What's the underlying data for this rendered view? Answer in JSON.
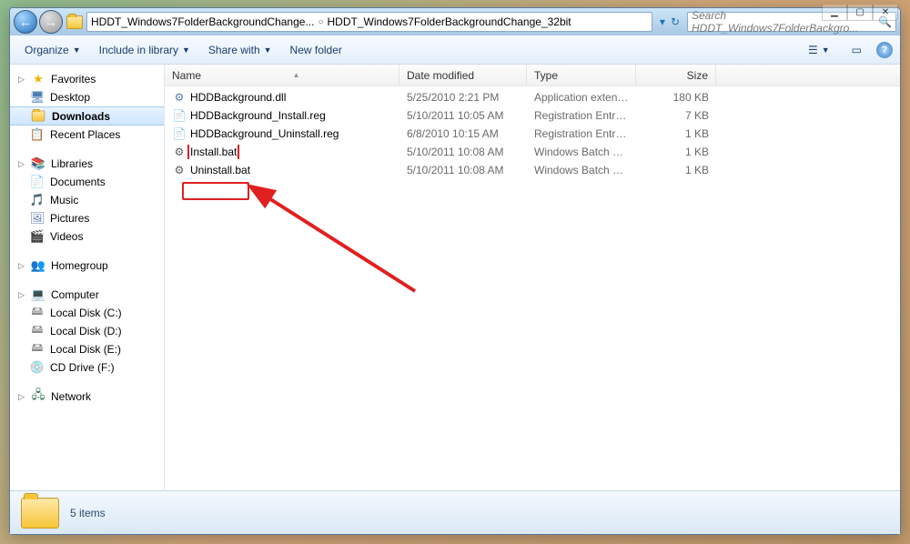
{
  "titlebar": {
    "back_glyph": "←",
    "fwd_glyph": "→",
    "breadcrumb": {
      "seg1": "HDDT_Windows7FolderBackgroundChange...",
      "seg2": "HDDT_Windows7FolderBackgroundChange_32bit"
    },
    "refresh_glyph": "↻",
    "dropdown_glyph": "▾",
    "search_placeholder": "Search HDDT_Windows7FolderBackgro...",
    "search_glyph": "🔍"
  },
  "winbtns": {
    "min": "▁",
    "max": "▢",
    "close": "✕"
  },
  "toolbar": {
    "organize": "Organize",
    "include": "Include in library",
    "share": "Share with",
    "newfolder": "New folder",
    "view_glyph": "☰",
    "preview_glyph": "▭",
    "help_glyph": "?"
  },
  "sidebar": {
    "favorites": "Favorites",
    "desktop": "Desktop",
    "downloads": "Downloads",
    "recent": "Recent Places",
    "libraries": "Libraries",
    "documents": "Documents",
    "music": "Music",
    "pictures": "Pictures",
    "videos": "Videos",
    "homegroup": "Homegroup",
    "computer": "Computer",
    "localC": "Local Disk (C:)",
    "localD": "Local Disk (D:)",
    "localE": "Local Disk (E:)",
    "cdF": "CD Drive (F:)",
    "network": "Network"
  },
  "columns": {
    "name": "Name",
    "date": "Date modified",
    "type": "Type",
    "size": "Size"
  },
  "files": [
    {
      "name": "HDDBackground.dll",
      "date": "5/25/2010 2:21 PM",
      "type": "Application extensi...",
      "size": "180 KB",
      "ico": "dll"
    },
    {
      "name": "HDDBackground_Install.reg",
      "date": "5/10/2011 10:05 AM",
      "type": "Registration Entries",
      "size": "7 KB",
      "ico": "reg"
    },
    {
      "name": "HDDBackground_Uninstall.reg",
      "date": "6/8/2010 10:15 AM",
      "type": "Registration Entries",
      "size": "1 KB",
      "ico": "reg"
    },
    {
      "name": "Install.bat",
      "date": "5/10/2011 10:08 AM",
      "type": "Windows Batch File",
      "size": "1 KB",
      "ico": "bat",
      "selected": true
    },
    {
      "name": "Uninstall.bat",
      "date": "5/10/2011 10:08 AM",
      "type": "Windows Batch File",
      "size": "1 KB",
      "ico": "bat"
    }
  ],
  "status": {
    "count": "5 items"
  }
}
